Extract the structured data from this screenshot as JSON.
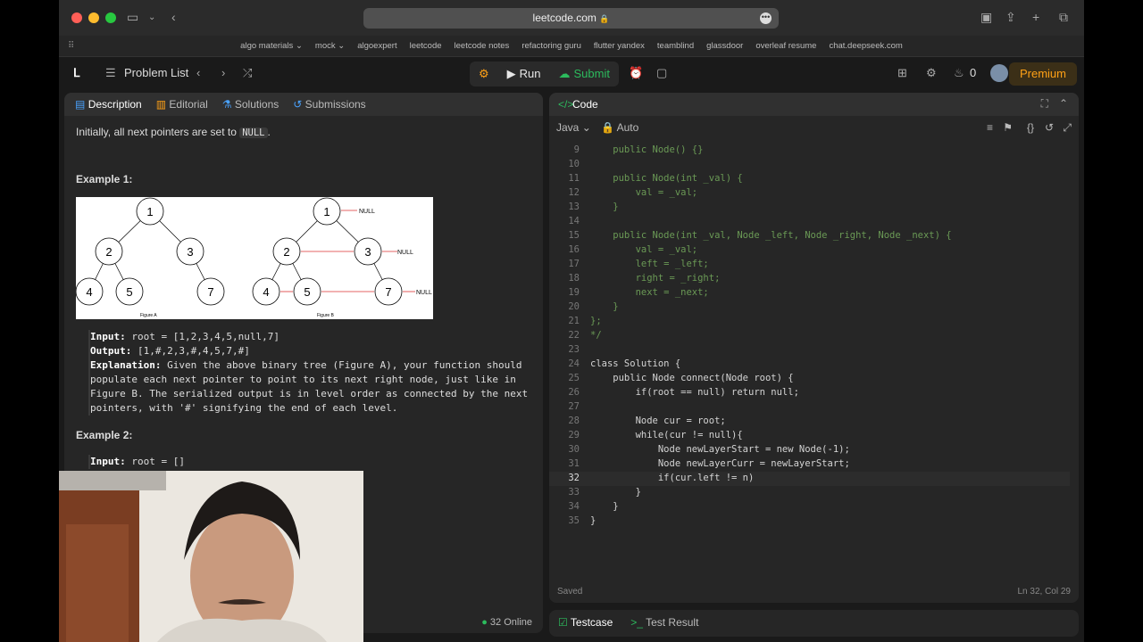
{
  "browser": {
    "url": "leetcode.com"
  },
  "bookmarks": [
    "algo materials ⌄",
    "mock ⌄",
    "algoexpert",
    "leetcode",
    "leetcode notes",
    "refactoring guru",
    "flutter yandex",
    "teamblind",
    "glassdoor",
    "overleaf resume",
    "chat.deepseek.com"
  ],
  "nav": {
    "problem_list": "Problem List",
    "run": "Run",
    "submit": "Submit",
    "coins": "0",
    "premium": "Premium"
  },
  "left_tabs": [
    "Description",
    "Editorial",
    "Solutions",
    "Submissions"
  ],
  "description": {
    "intro_prefix": "Initially, all next pointers are set to",
    "intro_code": "NULL",
    "intro_suffix": ".",
    "example1_title": "Example 1:",
    "input_label": "Input:",
    "input_value": "root = [1,2,3,4,5,null,7]",
    "output_label": "Output:",
    "output_value": "[1,#,2,3,#,4,5,7,#]",
    "explanation_label": "Explanation:",
    "explanation_text": "Given the above binary tree (Figure A), your function should populate each next pointer to point to its next right node, just like in Figure B. The serialized output is in level order as connected by the next pointers, with '#' signifying the end of each level.",
    "example2_title": "Example 2:",
    "example2_input_label": "Input:",
    "example2_input_value": "root = []",
    "figure": {
      "null_label": "NULL",
      "figure_a": "Figure A",
      "figure_b": "Figure B",
      "tree_values": [
        "1",
        "2",
        "3",
        "4",
        "5",
        "7"
      ]
    },
    "online": "32 Online"
  },
  "code": {
    "title": "Code",
    "language": "Java",
    "mode": "Auto",
    "status_saved": "Saved",
    "cursor": "Ln 32, Col 29",
    "lines": [
      {
        "n": "9",
        "t": "    public Node() {}"
      },
      {
        "n": "10",
        "t": ""
      },
      {
        "n": "11",
        "t": "    public Node(int _val) {"
      },
      {
        "n": "12",
        "t": "        val = _val;"
      },
      {
        "n": "13",
        "t": "    }"
      },
      {
        "n": "14",
        "t": ""
      },
      {
        "n": "15",
        "t": "    public Node(int _val, Node _left, Node _right, Node _next) {"
      },
      {
        "n": "16",
        "t": "        val = _val;"
      },
      {
        "n": "17",
        "t": "        left = _left;"
      },
      {
        "n": "18",
        "t": "        right = _right;"
      },
      {
        "n": "19",
        "t": "        next = _next;"
      },
      {
        "n": "20",
        "t": "    }"
      },
      {
        "n": "21",
        "t": "};"
      },
      {
        "n": "22",
        "t": "*/"
      },
      {
        "n": "23",
        "t": ""
      },
      {
        "n": "24",
        "t": "class Solution {"
      },
      {
        "n": "25",
        "t": "    public Node connect(Node root) {"
      },
      {
        "n": "26",
        "t": "        if(root == null) return null;"
      },
      {
        "n": "27",
        "t": ""
      },
      {
        "n": "28",
        "t": "        Node cur = root;"
      },
      {
        "n": "29",
        "t": "        while(cur != null){"
      },
      {
        "n": "30",
        "t": "            Node newLayerStart = new Node(-1);"
      },
      {
        "n": "31",
        "t": "            Node newLayerCurr = newLayerStart;"
      },
      {
        "n": "32",
        "t": "            if(cur.left != n)"
      },
      {
        "n": "33",
        "t": "        }"
      },
      {
        "n": "34",
        "t": "    }"
      },
      {
        "n": "35",
        "t": "}"
      }
    ]
  },
  "bottom_tabs": {
    "testcase": "Testcase",
    "test_result": "Test Result"
  }
}
